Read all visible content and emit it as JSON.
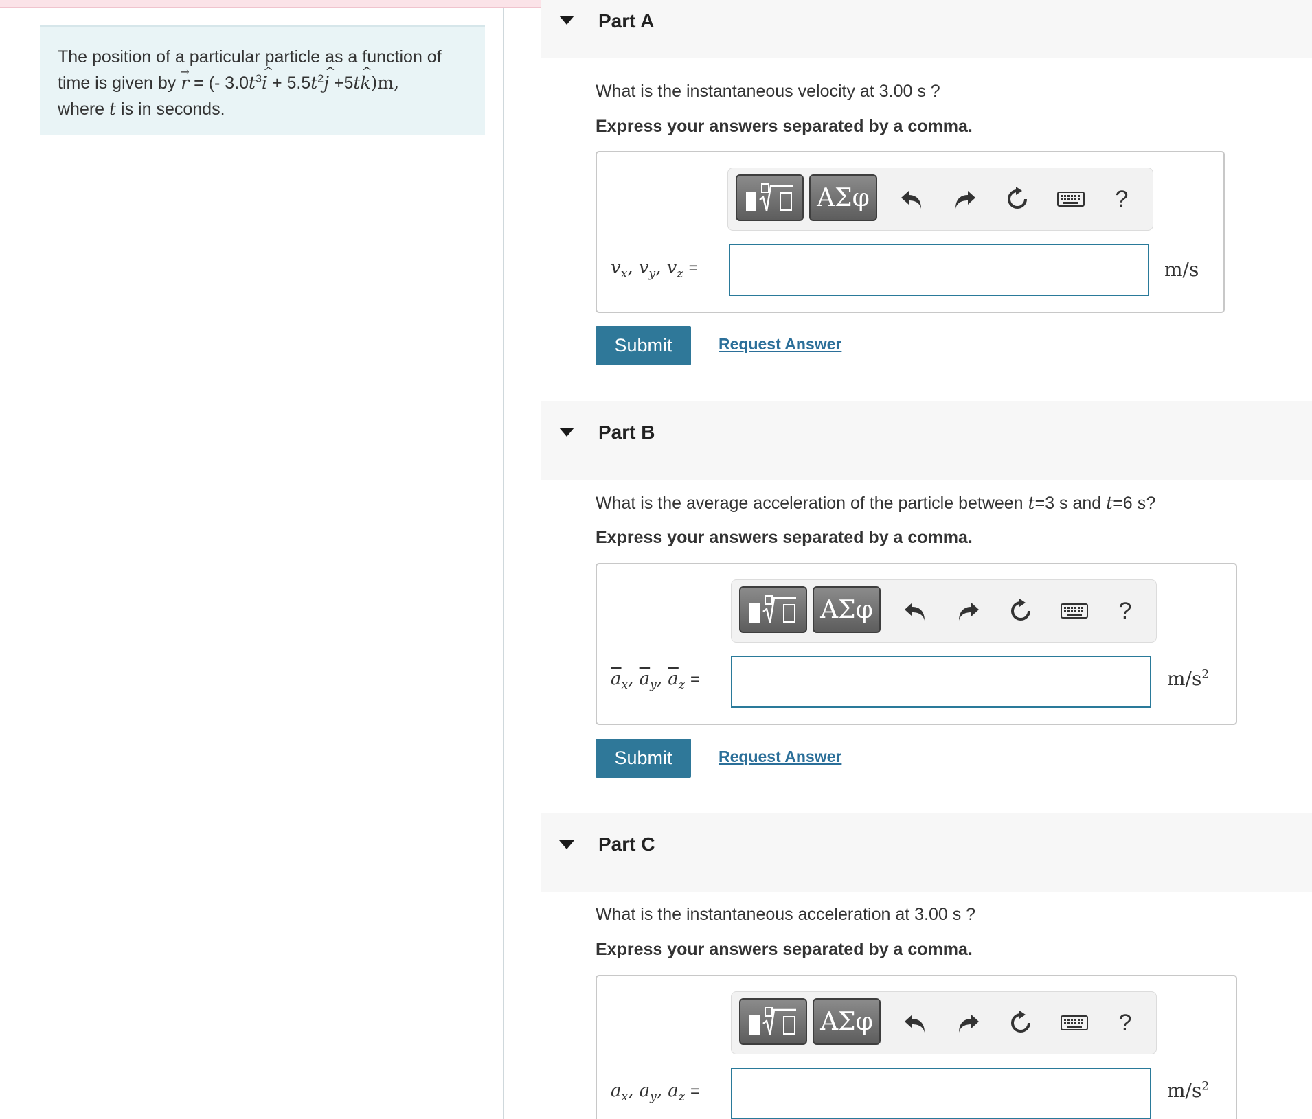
{
  "problem": {
    "line1": "The position of a particular particle as a function of",
    "line2_prefix": "time is given by",
    "line2_r": "r",
    "line2_eq": " = (- 3.0",
    "line2_t1": "t",
    "line2_exp1": "3",
    "line2_i": "i",
    "line2_plus1": " + 5.5",
    "line2_t2": "t",
    "line2_exp2": "2",
    "line2_j": "j",
    "line2_plus2": " +5",
    "line2_t3": "t",
    "line2_k": "k",
    "line2_suffix": ")m,",
    "line3_prefix": "where",
    "line3_t": "t",
    "line3_suffix": "is in seconds."
  },
  "toolbar": {
    "templates_icon": "templates-icon",
    "greek_label": "ΑΣφ",
    "undo_icon": "undo-icon",
    "redo_icon": "redo-icon",
    "reset_icon": "reset-icon",
    "keyboard_icon": "keyboard-icon",
    "help_label": "?"
  },
  "parts": [
    {
      "title": "Part A",
      "question": "What is the instantaneous velocity at 3.00 s ?",
      "instruction": "Express your answers separated by a comma.",
      "var_label": {
        "a": "v",
        "ax": "x",
        "b": "v",
        "bx": "y",
        "c": "v",
        "cx": "z",
        "eq": "="
      },
      "input_value": "",
      "unit": "m/s",
      "unit_exp": "",
      "submit_label": "Submit",
      "request_label": "Request Answer"
    },
    {
      "title": "Part B",
      "question_prefix": "What is the average acceleration of the particle between",
      "question_t1": "t",
      "question_mid": "=3 s and",
      "question_t2": "t",
      "question_eq2": "=6",
      "question_unit": "s",
      "question_end": "?",
      "instruction": "Express your answers separated by a comma.",
      "var_label": {
        "a": "a",
        "ax": "x",
        "b": "a",
        "bx": "y",
        "c": "a",
        "cx": "z",
        "eq": "="
      },
      "input_value": "",
      "unit": "m/s",
      "unit_exp": "2",
      "submit_label": "Submit",
      "request_label": "Request Answer"
    },
    {
      "title": "Part C",
      "question": "What is the instantaneous acceleration at 3.00 s ?",
      "instruction": "Express your answers separated by a comma.",
      "var_label": {
        "a": "a",
        "ax": "x",
        "b": "a",
        "bx": "y",
        "c": "a",
        "cx": "z",
        "eq": "="
      },
      "input_value": "",
      "unit": "m/s",
      "unit_exp": "2"
    }
  ]
}
